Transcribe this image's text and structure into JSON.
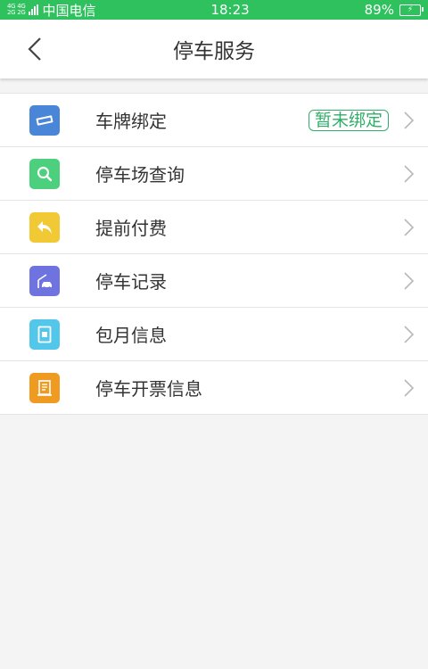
{
  "status": {
    "net_top": "4G 4G",
    "net_bottom": "2G 2G",
    "carrier": "中国电信",
    "time": "18:23",
    "battery": "89%"
  },
  "header": {
    "title": "停车服务"
  },
  "menu": [
    {
      "label": "车牌绑定",
      "badge": "暂未绑定",
      "icon": "license-plate-icon",
      "color": "#4a86d8"
    },
    {
      "label": "停车场查询",
      "icon": "search-icon",
      "color": "#4cd07d"
    },
    {
      "label": "提前付费",
      "icon": "reply-arrow-icon",
      "color": "#f1c934"
    },
    {
      "label": "停车记录",
      "icon": "car-barrier-icon",
      "color": "#6f73e0"
    },
    {
      "label": "包月信息",
      "icon": "card-icon",
      "color": "#53c7ea"
    },
    {
      "label": "停车开票信息",
      "icon": "invoice-icon",
      "color": "#ef9b22"
    }
  ]
}
